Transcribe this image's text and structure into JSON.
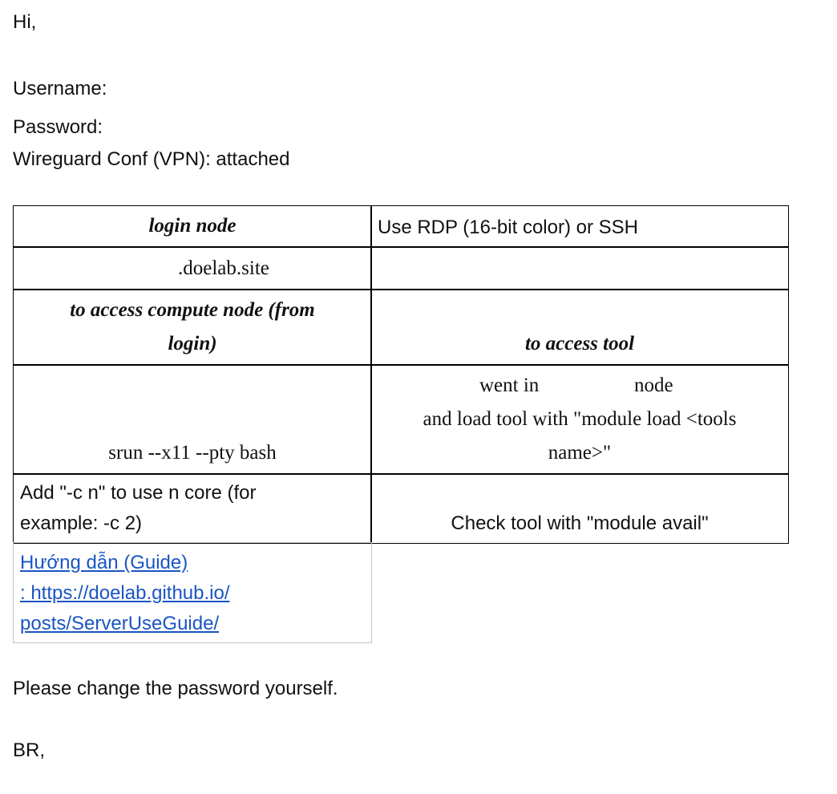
{
  "greeting": "Hi,",
  "credentials": {
    "username_label": "Username:",
    "password_label": "Password:",
    "vpn_line": "Wireguard Conf (VPN): attached"
  },
  "table": {
    "r1c1": "login node",
    "r1c2": "Use RDP (16-bit color) or SSH",
    "r2c1": ".doelab.site",
    "r2c2": "",
    "r3c1_line1": "to access compute node (from",
    "r3c1_line2": "login)",
    "r3c2": "to access tool",
    "r4c1": "srun --x11 --pty bash",
    "r4c2_line1_a": "went in",
    "r4c2_line1_b": "node",
    "r4c2_line2": "and load tool with \"module load <tools",
    "r4c2_line3": "name>\"",
    "r5c1_line1": "Add \"-c n\" to use n core (for",
    "r5c1_line2": "example: -c 2)",
    "r5c2": "Check tool with \"module avail\"",
    "guide_line1": "Hướng dẫn (Guide)",
    "guide_line2": ": https://doelab.github.io/",
    "guide_line3": "posts/ServerUseGuide/"
  },
  "closing": {
    "change_password": "Please change the password yourself.",
    "signoff": "BR,"
  },
  "colors": {
    "link": "#1a55c4",
    "border": "#000000",
    "light_border": "#c6c6c6"
  }
}
